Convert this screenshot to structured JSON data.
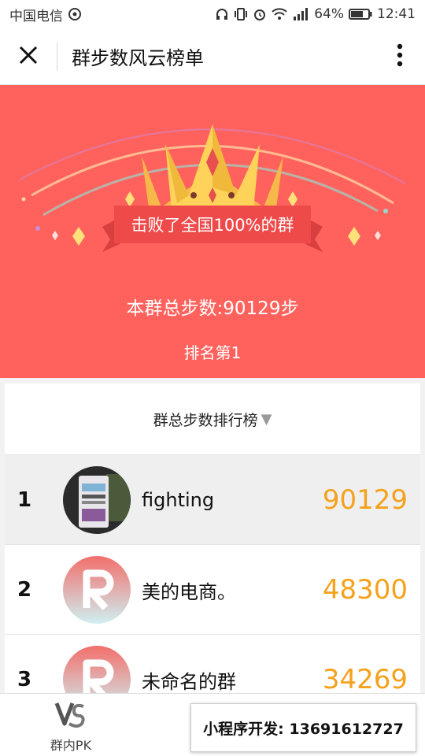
{
  "status_bar": {
    "carrier": "中国电信",
    "battery": "64%",
    "time": "12:41"
  },
  "nav": {
    "title": "群步数风云榜单"
  },
  "hero": {
    "defeat_text": "击败了全国100%的群",
    "total_steps": "本群总步数:90129步",
    "rank_text": "排名第1"
  },
  "list": {
    "header": "群总步数排行榜",
    "sort_indicator": "▼",
    "rows": [
      {
        "rank": "1",
        "name": "fighting",
        "steps": "90129",
        "avatar": "photo"
      },
      {
        "rank": "2",
        "name": "美的电商。",
        "steps": "48300",
        "avatar": "R-logo"
      },
      {
        "rank": "3",
        "name": "未命名的群",
        "steps": "34269",
        "avatar": "R-logo"
      }
    ]
  },
  "tabbar": {
    "pk_label": "群内PK"
  },
  "promo": {
    "text": "小程序开发: 13691612727"
  },
  "colors": {
    "hero_bg": "#ff625d",
    "steps": "#f5a11c",
    "ribbon": "#ee4a4a"
  }
}
